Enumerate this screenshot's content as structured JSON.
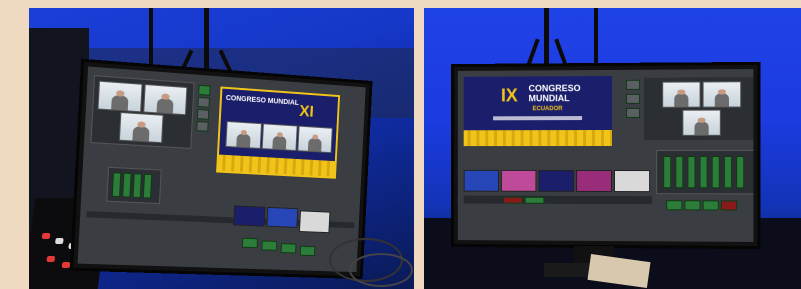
{
  "left_photo": {
    "screen_program": {
      "banner_line1": "CONGRESO MUNDIAL",
      "banner_line2": "XI"
    }
  },
  "right_photo": {
    "screen_program": {
      "roman": "IX",
      "line1": "CONGRESO",
      "line2": "MUNDIAL",
      "line3": "ECUADOR"
    }
  },
  "colors": {
    "backdrop_blue": "#1c3be0",
    "banner_yellow": "#f0c419",
    "banner_navy": "#1b1f6b"
  }
}
